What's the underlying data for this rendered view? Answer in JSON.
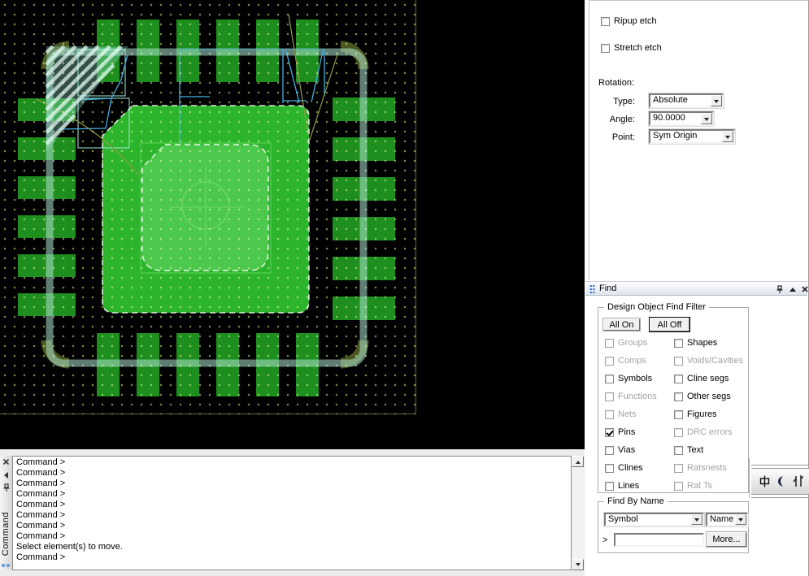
{
  "colors": {
    "canvas_bg": "#000000",
    "grid_dot": "#6b7a3f",
    "pad_green": "#1e8e1e",
    "thermal_pad_green": "#2db42d",
    "paste_pad_green": "#4cc84c",
    "outline_teal": "#aee4d2",
    "corner_mark_olive": "#4e5c22",
    "rat_line_cyan": "#45b1e4",
    "rat_line_olive": "#8f9d4b",
    "gripper_blue": "#2f6fd0",
    "disabled_text": "#a3a3a3"
  },
  "options_panel": {
    "ripup": {
      "label": "Ripup etch",
      "checked": false,
      "enabled": true
    },
    "stretch": {
      "label": "Stretch etch",
      "checked": false,
      "enabled": true
    },
    "rotation_heading": "Rotation:",
    "type_label": "Type:",
    "type_value": "Absolute",
    "angle_label": "Angle:",
    "angle_value": "90.0000",
    "point_label": "Point:",
    "point_value": "Sym Origin"
  },
  "find_panel": {
    "title": "Find",
    "filter_group_label": "Design Object Find Filter",
    "all_on_label": "All On",
    "all_off_label": "All Off",
    "filters": [
      {
        "label": "Groups",
        "checked": false,
        "enabled": false
      },
      {
        "label": "Shapes",
        "checked": false,
        "enabled": true
      },
      {
        "label": "Comps",
        "checked": false,
        "enabled": false
      },
      {
        "label": "Voids/Cavities",
        "checked": false,
        "enabled": false
      },
      {
        "label": "Symbols",
        "checked": false,
        "enabled": true
      },
      {
        "label": "Cline segs",
        "checked": false,
        "enabled": true
      },
      {
        "label": "Functions",
        "checked": false,
        "enabled": false
      },
      {
        "label": "Other segs",
        "checked": false,
        "enabled": true
      },
      {
        "label": "Nets",
        "checked": false,
        "enabled": false
      },
      {
        "label": "Figures",
        "checked": false,
        "enabled": true
      },
      {
        "label": "Pins",
        "checked": true,
        "enabled": true
      },
      {
        "label": "DRC errors",
        "checked": false,
        "enabled": false
      },
      {
        "label": "Vias",
        "checked": false,
        "enabled": true
      },
      {
        "label": "Text",
        "checked": false,
        "enabled": true
      },
      {
        "label": "Clines",
        "checked": false,
        "enabled": true
      },
      {
        "label": "Ratsnests",
        "checked": false,
        "enabled": false
      },
      {
        "label": "Lines",
        "checked": false,
        "enabled": true
      },
      {
        "label": "Rat Ts",
        "checked": false,
        "enabled": false
      }
    ],
    "by_name": {
      "group_label": "Find By Name",
      "category_value": "Symbol",
      "mode_value": "Name",
      "prompt": ">",
      "input_value": "",
      "more_label": "More..."
    }
  },
  "console": {
    "tab_label": "Command",
    "lines": [
      "Command > ",
      "Command > ",
      "Command > ",
      "Command > ",
      "Command > ",
      "Command > ",
      "Command > ",
      "Command > ",
      "Select element(s) to move.",
      "Command > "
    ]
  },
  "ime_bar": {
    "glyphs": [
      "中",
      "☽",
      "仆"
    ]
  },
  "icons": {
    "combo_arrow": "▼",
    "scroll_up": "▲",
    "scroll_down": "▼",
    "dock_pin": "pushpin",
    "dock_collapse": "▲",
    "dock_close": "✕",
    "console_close": "✕",
    "console_collapse": "◄",
    "console_pin": "pushpin"
  }
}
